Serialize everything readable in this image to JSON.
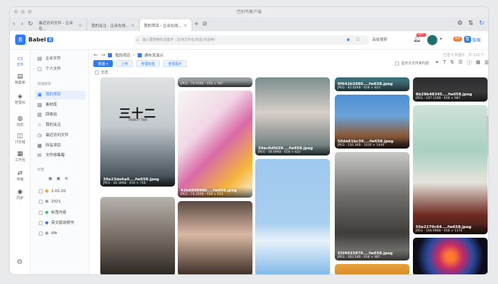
{
  "window": {
    "title": "巴别鸟客户端"
  },
  "tabs": [
    {
      "label": "最近访问文件 - 企业在..."
    },
    {
      "label": "我的关注 - 企业在线..."
    },
    {
      "label": "我的项目 - 企业在线..."
    }
  ],
  "app": {
    "name": "Babel",
    "tag": "云"
  },
  "search": {
    "placeholder": "输入要搜索的关键字（支持文件名/标签/内容等）",
    "advanced": "高级搜索"
  },
  "notifications": {
    "badge": "99+"
  },
  "account": {
    "vip": "VIP",
    "team": "智展"
  },
  "rail": [
    {
      "icon": "▭",
      "label": "文件"
    },
    {
      "icon": "▤",
      "label": "档案库"
    },
    {
      "icon": "◈",
      "label": "智慧AI"
    },
    {
      "icon": "◍",
      "label": "动态"
    },
    {
      "icon": "◫",
      "label": "讨论组"
    },
    {
      "icon": "▦",
      "label": "工作台"
    },
    {
      "icon": "⇄",
      "label": "传输"
    },
    {
      "icon": "◉",
      "label": "同步"
    }
  ],
  "sidebar": {
    "top": [
      {
        "icon": "▤",
        "label": "企业文件"
      },
      {
        "icon": "▢",
        "label": "个人文件"
      }
    ],
    "quick_title": "快捷菜单",
    "quick": [
      {
        "icon": "▣",
        "label": "我的项目"
      },
      {
        "icon": "▨",
        "label": "素材库"
      },
      {
        "icon": "▥",
        "label": "回收站"
      },
      {
        "icon": "☆",
        "label": "我的关注"
      },
      {
        "icon": "◷",
        "label": "最近访问文件"
      },
      {
        "icon": "▦",
        "label": "所有项目"
      },
      {
        "icon": "✉",
        "label": "文件收集箱"
      }
    ],
    "tags_title": "标签",
    "tags": [
      {
        "dot": "●",
        "label": "1-01-02",
        "color": "#ff9f2f"
      },
      {
        "dot": "●",
        "label": "2021",
        "color": "#9aa0a6"
      },
      {
        "dot": "●",
        "label": "标签内容",
        "color": "#3ec46d"
      },
      {
        "dot": "●",
        "label": "英文版说明书",
        "color": "#2f7cf6"
      },
      {
        "dot": "●",
        "label": "IPA",
        "color": "#9aa0a6"
      }
    ]
  },
  "breadcrumb": {
    "root": "我的项目",
    "current": "通布流演示",
    "right": "已选 0 张图片，共 123 个"
  },
  "toolbar": {
    "new": "新建 ▾",
    "upload": "上传",
    "manage_tags": "管理标签",
    "view_image": "查看图片"
  },
  "select_all": "全选",
  "show_sub": "显示子文件夹内容",
  "cards": [
    {
      "name": "39a23de6a0....fw658.jpeg",
      "meta": "JPEG · 46.36KB · 450 × 718"
    },
    {
      "name": "",
      "meta": ""
    },
    {
      "name": "",
      "meta": "JPEG · 79.92KB · 658 × 987"
    },
    {
      "name": "42b8898980....fw658.jpeg",
      "meta": "JPEG · 74.35KB · 658 × 911"
    },
    {
      "name": "",
      "meta": ""
    },
    {
      "name": "34ac0dfd29....fw658.jpeg",
      "meta": "JPEG · 56.69KB · 658 × 822"
    },
    {
      "name": "",
      "meta": ""
    },
    {
      "name": "9f642b3680....fw658.jpeg",
      "meta": "JPEG · 62.02KB · 658 × 823"
    },
    {
      "name": "50da61bc39....fw658.jpeg",
      "meta": "JPEG · 530.3KB · 1020 × 1440"
    },
    {
      "name": "55f4933870....fw658.jpeg",
      "meta": "JPEG · 283.5KB · 658 × 987"
    },
    {
      "name": "",
      "meta": ""
    },
    {
      "name": "8b29b48345....fw658.jpeg",
      "meta": "JPEG · 147.11KB · 658 × 987"
    },
    {
      "name": "55e2170c64....fw658.jpeg",
      "meta": "JPEG · 106.09KB · 658 × 1170"
    },
    {
      "name": "",
      "meta": ""
    }
  ],
  "poster": {
    "title": "三十二",
    "subtitle": "TWENTY TWO"
  },
  "colors": {
    "accent": "#2f7cf6",
    "badge": "#f24b4b",
    "vip": "#ff7a2f"
  }
}
